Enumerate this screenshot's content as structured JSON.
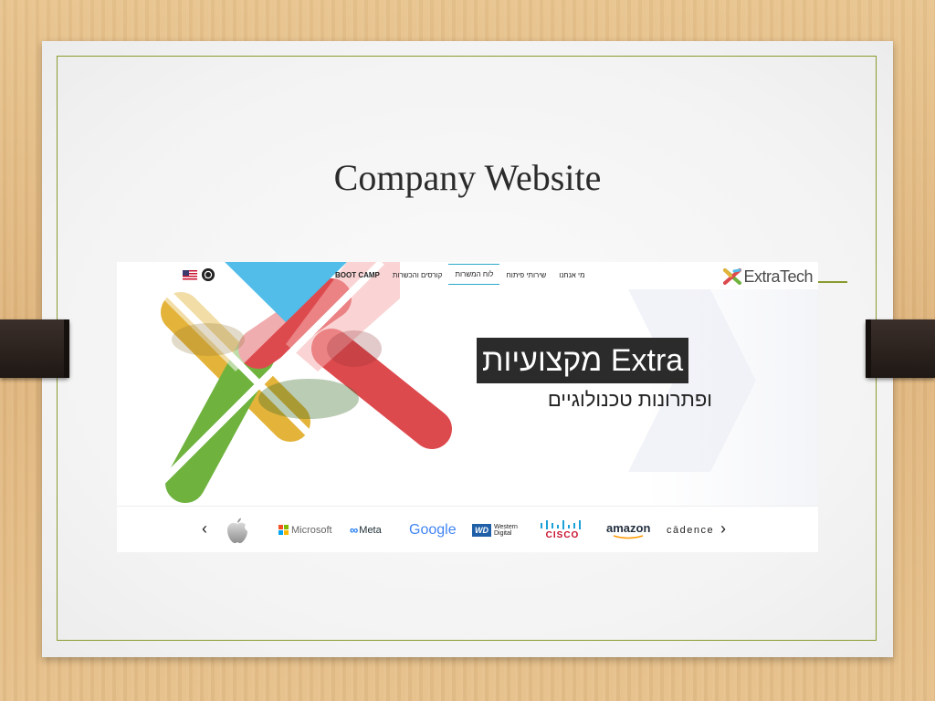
{
  "slide": {
    "title": "Company Website"
  },
  "website": {
    "logo_text": "ExtraTech",
    "nav": {
      "items": [
        "מי אנחנו",
        "שירותי פיתוח",
        "לוח המשרות",
        "קורסים והכשרות",
        "BOOT CAMP"
      ],
      "active_index": 2
    },
    "hero": {
      "title": "Extra מקצועיות",
      "subtitle": "ופתרונות טכנולוגיים"
    },
    "language_flag": "us-flag-icon",
    "contact_icon": "whatsapp-icon",
    "partners": {
      "prev_label": "‹",
      "next_label": "›",
      "logos": [
        "apple",
        "Microsoft",
        "Meta",
        "Google",
        "Western Digital",
        "CISCO",
        "amazon",
        "cadence"
      ],
      "labels": {
        "microsoft": "Microsoft",
        "meta": "Meta",
        "google": "Google",
        "wd_badge": "WD",
        "wd_text1": "Western",
        "wd_text2": "Digital",
        "cisco": "CISCO",
        "amazon": "amazon",
        "cadence": "cādence"
      }
    }
  },
  "colors": {
    "frame": "#8a9a2e",
    "x_yellow": "#e3b33a",
    "x_red": "#dd4a4e",
    "x_green": "#6fb33e",
    "x_blue": "#52bde9",
    "hero_box": "#2b2b2b"
  }
}
